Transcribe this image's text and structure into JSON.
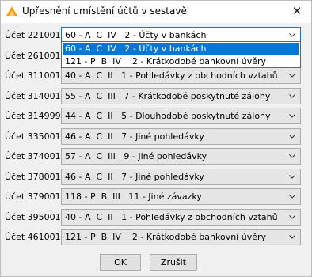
{
  "window": {
    "title": "Upřesnění umístění účtů v sestavě",
    "close_glyph": "✕"
  },
  "dropdown_options": [
    {
      "label": "60 - A  C  IV   2 - Účty v bankách",
      "selected": true
    },
    {
      "label": "121 - P  B  IV    2 - Krátkodobé bankovní úvěry",
      "selected": false
    }
  ],
  "rows": [
    {
      "label": "Účet 221001:",
      "value": "60 - A  C  IV   2 - Účty v bankách",
      "open": true
    },
    {
      "label": "Účet 261001:",
      "value": ""
    },
    {
      "label": "Účet 311001:",
      "value": "40 - A  C  II   1 - Pohledávky z obchodních vztahů"
    },
    {
      "label": "Účet 314001:",
      "value": "55 - A  C  III   7 - Krátkodobé poskytnuté zálohy"
    },
    {
      "label": "Účet 314999:",
      "value": "44 - A  C  II   5 - Dlouhodobé poskytnuté zálohy"
    },
    {
      "label": "Účet 335001:",
      "value": "46 - A  C  II   7 - Jiné pohledávky"
    },
    {
      "label": "Účet 374001:",
      "value": "57 - A  C  III   9 - Jiné pohledávky"
    },
    {
      "label": "Účet 378001:",
      "value": "46 - A  C  II   7 - Jiné pohledávky"
    },
    {
      "label": "Účet 379001:",
      "value": "118 - P  B  III   11 - Jiné závazky"
    },
    {
      "label": "Účet 395001:",
      "value": "40 - A  C  II   1 - Pohledávky z obchodních vztahů"
    },
    {
      "label": "Účet 461001:",
      "value": "121 - P  B  IV    2 - Krátkodobé bankovní úvěry"
    }
  ],
  "buttons": {
    "ok": "OK",
    "cancel": "Zrušit"
  },
  "colors": {
    "selection": "#0078d7",
    "focus_border": "#0078d7",
    "combo_bg": "#e5e5e5",
    "dialog_bg": "#f0f0f0"
  },
  "icons": {
    "app": "app-logo-icon",
    "close": "close-icon",
    "combo": "chevron-down-icon"
  }
}
